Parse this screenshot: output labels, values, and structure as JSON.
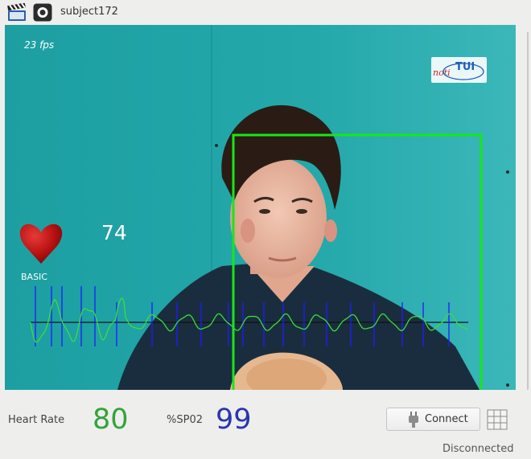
{
  "window": {
    "title": "subject172",
    "toolbar_icons": [
      "clapperboard-icon",
      "record-icon"
    ]
  },
  "video": {
    "fps_text": "23 fps",
    "overlay_heart_rate": "74",
    "waveform_label": "BASIC",
    "logo_text": "TUI",
    "colors": {
      "wall": "#1fa2a5",
      "face_box": "#19e619",
      "waveform_green": "#3bdd3b",
      "waveform_blue": "#1c1cff",
      "heart": "#b51010"
    }
  },
  "readout": {
    "heart_rate_label": "Heart Rate",
    "heart_rate_value": "80",
    "spo2_label": "%SP02",
    "spo2_value": "99",
    "colors": {
      "heart_rate": "#33a33a",
      "spo2": "#2b35b0"
    }
  },
  "controls": {
    "connect_label": "Connect",
    "status": "Disconnected"
  }
}
